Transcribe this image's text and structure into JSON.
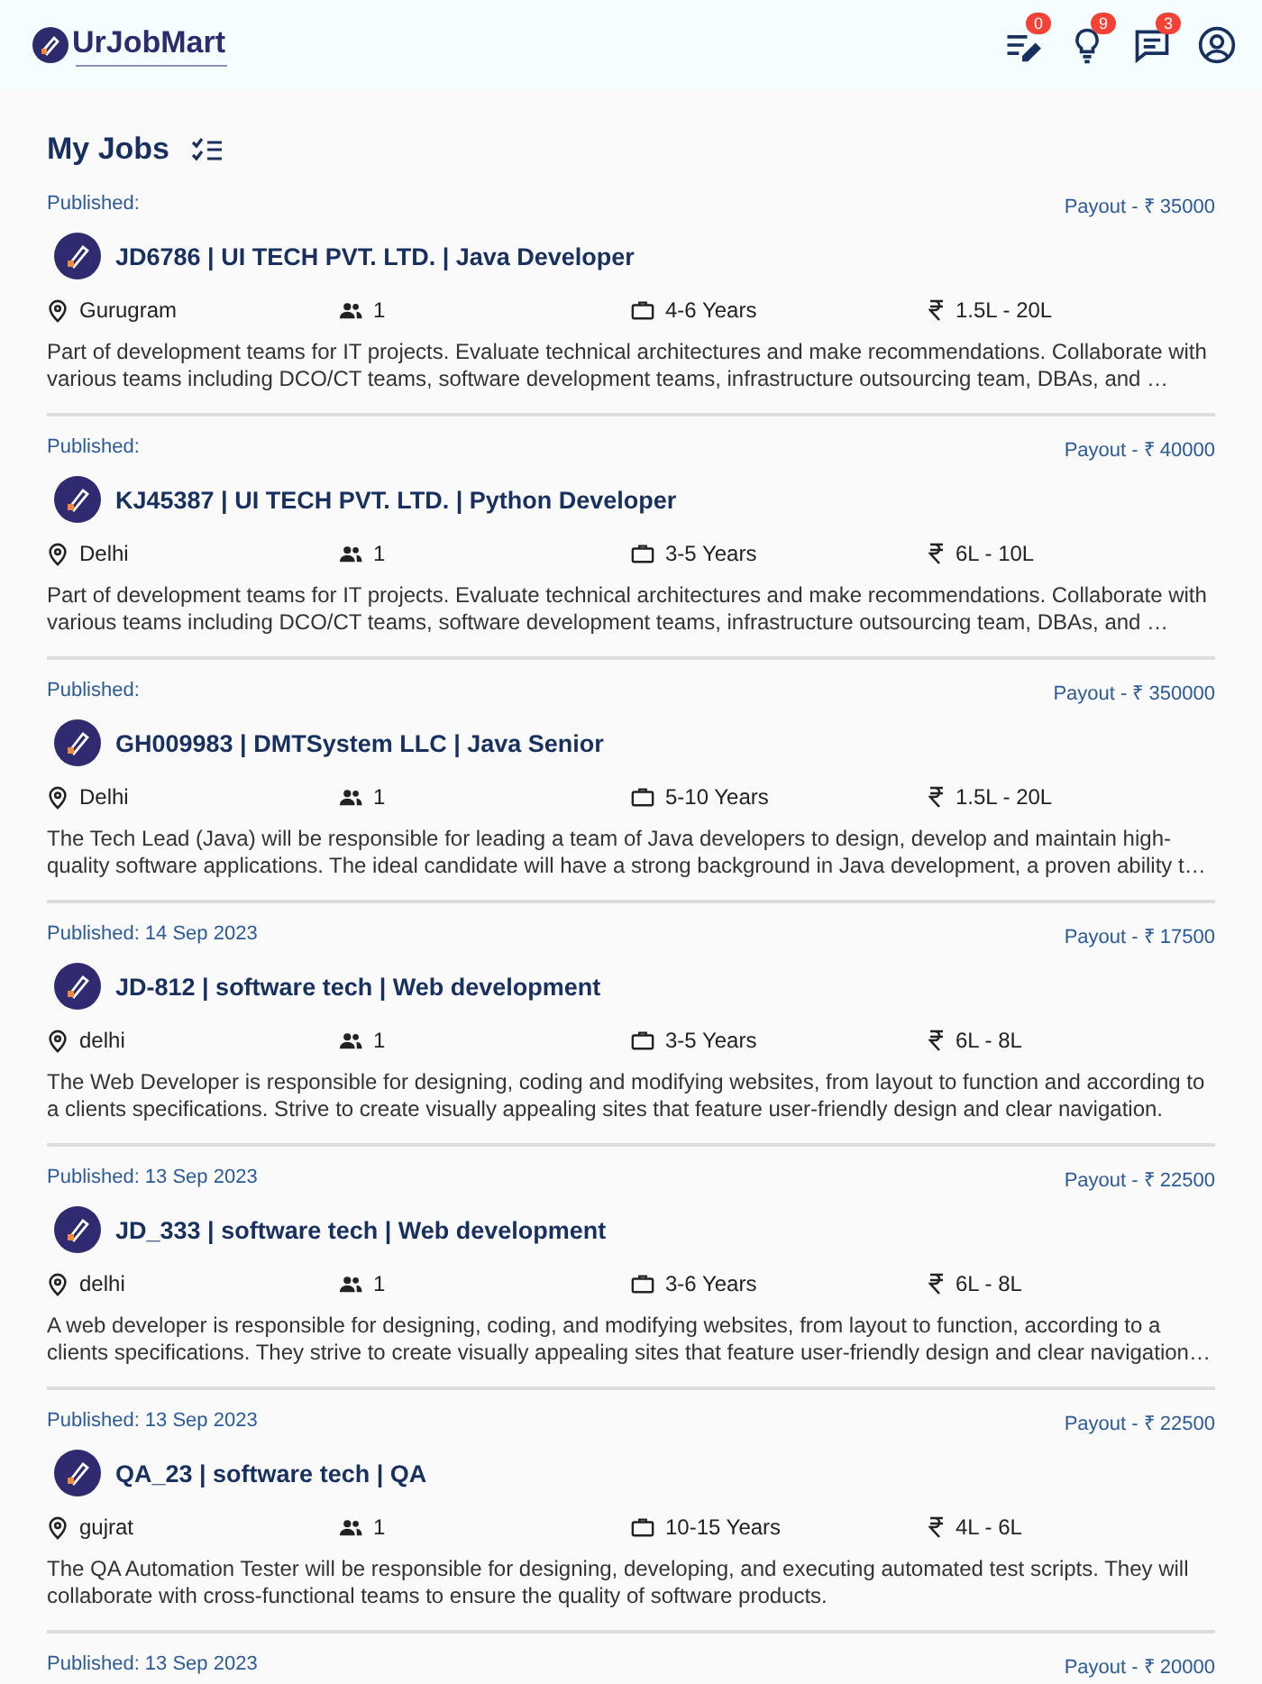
{
  "header": {
    "logo": "UrJobMart",
    "notifications": [
      {
        "count": "0"
      },
      {
        "count": "9"
      },
      {
        "count": "3"
      }
    ]
  },
  "page_title": "My Jobs",
  "jobs": [
    {
      "published": "Published:",
      "payout": "Payout - ₹ 35000",
      "title": "JD6786 | UI TECH PVT. LTD. | Java Developer",
      "location": "Gurugram",
      "openings": "1",
      "experience": "4-6 Years",
      "salary": "1.5L - 20L",
      "description": "Part of development teams for IT projects. Evaluate technical architectures and make recommendations. Collaborate with various teams including DCO/CT teams, software development teams, infrastructure outsourcing team, DBAs, and …"
    },
    {
      "published": "Published:",
      "payout": "Payout - ₹ 40000",
      "title": "KJ45387 | UI TECH PVT. LTD. | Python Developer",
      "location": "Delhi",
      "openings": "1",
      "experience": "3-5 Years",
      "salary": "6L - 10L",
      "description": "Part of development teams for IT projects. Evaluate technical architectures and make recommendations. Collaborate with various teams including DCO/CT teams, software development teams, infrastructure outsourcing team, DBAs, and …"
    },
    {
      "published": "Published:",
      "payout": "Payout - ₹ 350000",
      "title": "GH009983 | DMTSystem LLC | Java Senior",
      "location": "Delhi",
      "openings": "1",
      "experience": "5-10 Years",
      "salary": "1.5L - 20L",
      "description": "The Tech Lead (Java) will be responsible for leading a team of Java developers to design, develop and maintain high-quality software applications. The ideal candidate will have a strong background in Java development, a proven ability t…"
    },
    {
      "published": "Published: 14 Sep 2023",
      "payout": "Payout - ₹ 17500",
      "title": "JD-812 | software tech | Web development",
      "location": "delhi",
      "openings": "1",
      "experience": "3-5 Years",
      "salary": "6L - 8L",
      "description": "The Web Developer is responsible for designing, coding and modifying websites, from layout to function and according to a clients specifications. Strive to create visually appealing sites that feature user-friendly design and clear navigation."
    },
    {
      "published": "Published: 13 Sep 2023",
      "payout": "Payout - ₹ 22500",
      "title": "JD_333 | software tech | Web development",
      "location": "delhi",
      "openings": "1",
      "experience": "3-6 Years",
      "salary": "6L - 8L",
      "description": "A web developer is responsible for designing, coding, and modifying websites, from layout to function, according to a clients specifications. They strive to create visually appealing sites that feature user-friendly design and clear navigation…"
    },
    {
      "published": "Published: 13 Sep 2023",
      "payout": "Payout - ₹ 22500",
      "title": "QA_23 | software tech | QA",
      "location": "gujrat",
      "openings": "1",
      "experience": "10-15 Years",
      "salary": "4L - 6L",
      "description": "The QA Automation Tester will be responsible for designing, developing, and executing automated test scripts. They will collaborate with cross-functional teams to ensure the quality of software products."
    },
    {
      "published": "Published: 13 Sep 2023",
      "payout": "Payout - ₹ 20000"
    }
  ]
}
